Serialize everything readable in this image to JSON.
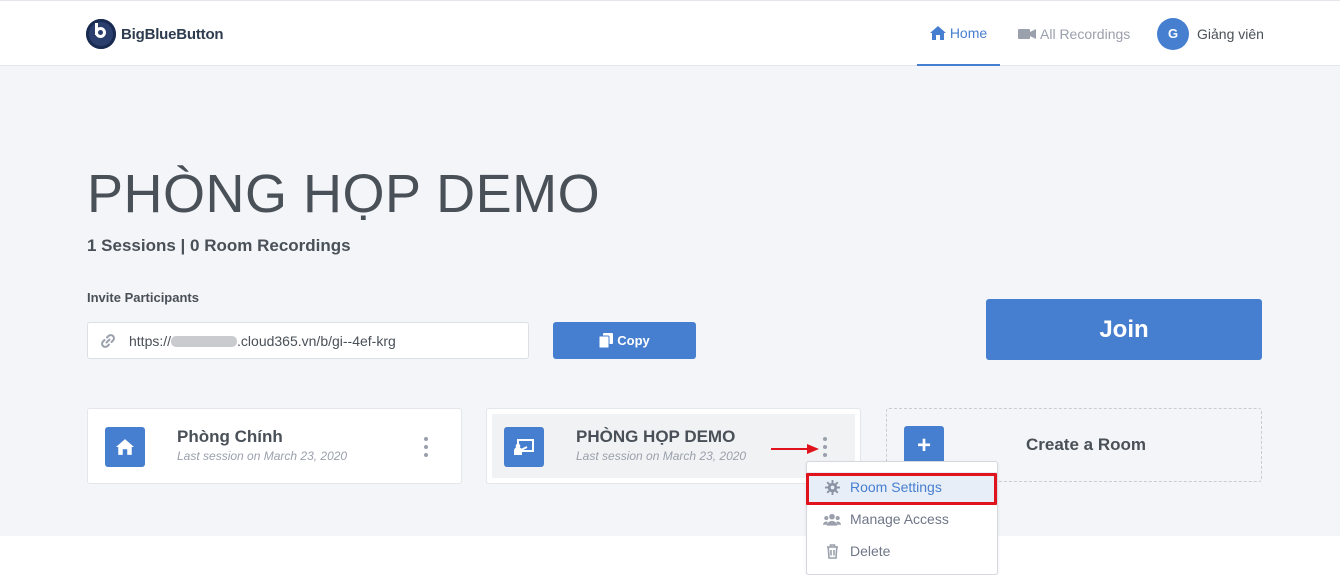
{
  "header": {
    "logo_text": "BigBlueButton",
    "nav": [
      {
        "label": "Home",
        "icon": "home-icon",
        "active": true
      },
      {
        "label": "All Recordings",
        "icon": "video-camera-icon",
        "active": false
      }
    ],
    "user": {
      "initial": "G",
      "name": "Giảng viên"
    }
  },
  "room": {
    "title": "PHÒNG HỌP DEMO",
    "stats": "1 Sessions | 0 Room Recordings",
    "invite_label": "Invite Participants",
    "invite_url_prefix": "https://",
    "invite_url_suffix": ".cloud365.vn/b/gi--4ef-krg",
    "copy_label": "Copy",
    "join_label": "Join"
  },
  "rooms": [
    {
      "name": "Phòng Chính",
      "last_session": "Last session on March 23, 2020",
      "icon": "home-icon"
    },
    {
      "name": "PHÒNG HỌP DEMO",
      "last_session": "Last session on March 23, 2020",
      "icon": "presentation-icon"
    }
  ],
  "create_room": {
    "label": "Create a Room",
    "icon": "plus-icon"
  },
  "menu": {
    "items": [
      {
        "label": "Room Settings",
        "icon": "gear-icon"
      },
      {
        "label": "Manage Access",
        "icon": "users-icon"
      },
      {
        "label": "Delete",
        "icon": "trash-icon"
      }
    ]
  },
  "colors": {
    "accent": "#467fcf",
    "annotation": "#e0121c",
    "background": "#f4f5f9"
  }
}
